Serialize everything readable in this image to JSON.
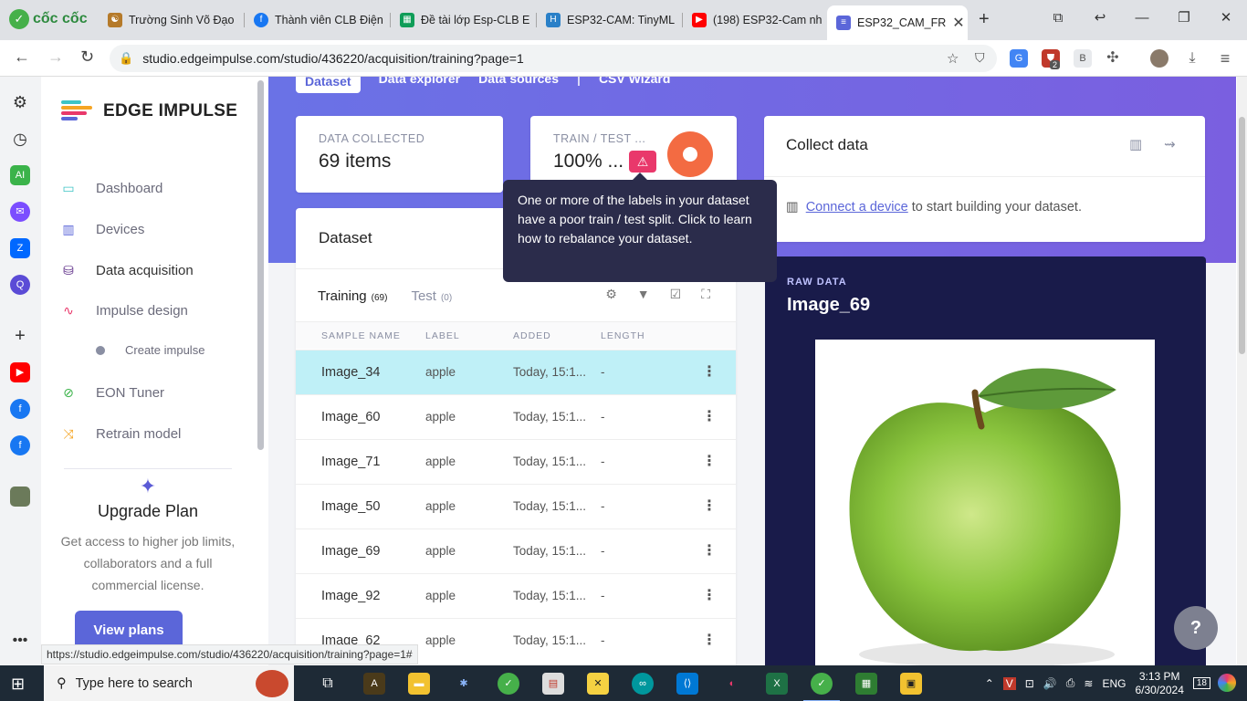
{
  "browser": {
    "brand": "cốc cốc",
    "tabs": [
      {
        "title": "Trường Sinh Võ Đạo",
        "color": "#b57a2a"
      },
      {
        "title": "Thành viên CLB Điện",
        "color": "#1877f2"
      },
      {
        "title": "Đề tài lớp Esp-CLB E",
        "color": "#0f9d58"
      },
      {
        "title": "ESP32-CAM: TinyML",
        "color": "#2a80c8"
      },
      {
        "title": "(198) ESP32-Cam nh",
        "color": "#ff0000"
      },
      {
        "title": "ESP32_CAM_FR",
        "color": "#5b66d9"
      }
    ],
    "url": "studio.edgeimpulse.com/studio/436220/acquisition/training?page=1",
    "status_url": "https://studio.edgeimpulse.com/studio/436220/acquisition/training?page=1#",
    "extension_badge": "2"
  },
  "sidebar": {
    "logo_text": "EDGE IMPULSE",
    "items": [
      {
        "label": "Dashboard"
      },
      {
        "label": "Devices"
      },
      {
        "label": "Data acquisition"
      },
      {
        "label": "Impulse design"
      },
      {
        "label": "Create impulse"
      },
      {
        "label": "EON Tuner"
      },
      {
        "label": "Retrain model"
      }
    ],
    "upgrade": {
      "title": "Upgrade Plan",
      "text": "Get access to higher job limits, collaborators and a full commercial license.",
      "button": "View plans"
    }
  },
  "main": {
    "tabs": [
      "Dataset",
      "Data explorer",
      "Data sources",
      "|",
      "CSV Wizard"
    ],
    "data_collected": {
      "label": "DATA COLLECTED",
      "value": "69 items"
    },
    "train_test": {
      "label": "TRAIN / TEST ...",
      "value": "100% ..."
    },
    "tooltip": "One or more of the labels in your dataset have a poor train / test split. Click to learn how to rebalance your dataset.",
    "dataset": {
      "title": "Dataset",
      "tabs": [
        {
          "label": "Training",
          "count": "(69)"
        },
        {
          "label": "Test",
          "count": "(0)"
        }
      ],
      "columns": [
        "SAMPLE NAME",
        "LABEL",
        "ADDED",
        "LENGTH"
      ],
      "rows": [
        {
          "name": "Image_34",
          "label": "apple",
          "added": "Today, 15:1...",
          "length": "-"
        },
        {
          "name": "Image_60",
          "label": "apple",
          "added": "Today, 15:1...",
          "length": "-"
        },
        {
          "name": "Image_71",
          "label": "apple",
          "added": "Today, 15:1...",
          "length": "-"
        },
        {
          "name": "Image_50",
          "label": "apple",
          "added": "Today, 15:1...",
          "length": "-"
        },
        {
          "name": "Image_69",
          "label": "apple",
          "added": "Today, 15:1...",
          "length": "-"
        },
        {
          "name": "Image_92",
          "label": "apple",
          "added": "Today, 15:1...",
          "length": "-"
        },
        {
          "name": "Image_62",
          "label": "apple",
          "added": "Today, 15:1...",
          "length": "-"
        }
      ]
    },
    "collect": {
      "title": "Collect data",
      "link": "Connect a device",
      "text": " to start building your dataset."
    },
    "raw": {
      "label": "RAW DATA",
      "title": "Image_69"
    },
    "help": "?"
  },
  "taskbar": {
    "search_placeholder": "Type here to search",
    "lang": "ENG",
    "time": "3:13 PM",
    "date": "6/30/2024",
    "notifications": "18"
  }
}
